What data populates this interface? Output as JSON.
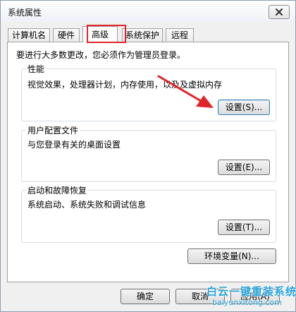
{
  "window": {
    "title": "系统属性"
  },
  "tabs": [
    {
      "label": "计算机名"
    },
    {
      "label": "硬件"
    },
    {
      "label": "高级"
    },
    {
      "label": "系统保护"
    },
    {
      "label": "远程"
    }
  ],
  "active_tab": "高级",
  "intro_text": "要进行大多数更改，您必须作为管理员登录。",
  "groups": {
    "performance": {
      "title": "性能",
      "description": "视觉效果，处理器计划，内存使用，以及及虚拟内存",
      "button": "设置(S)..."
    },
    "user_profiles": {
      "title": "用户配置文件",
      "description": "与您登录有关的桌面设置",
      "button": "设置(E)..."
    },
    "startup_recovery": {
      "title": "启动和故障恢复",
      "description": "系统启动、系统失败和调试信息",
      "button": "设置(T)..."
    }
  },
  "env_button": "环境变量(N)...",
  "footer": {
    "ok": "确定",
    "cancel": "取消",
    "apply": "应用(A)"
  },
  "watermark": {
    "brand": "白云一键重装系统",
    "url": "baiyunxitong.com"
  },
  "colors": {
    "highlight": "#e0242a",
    "watermark": "#2aa3d9"
  }
}
